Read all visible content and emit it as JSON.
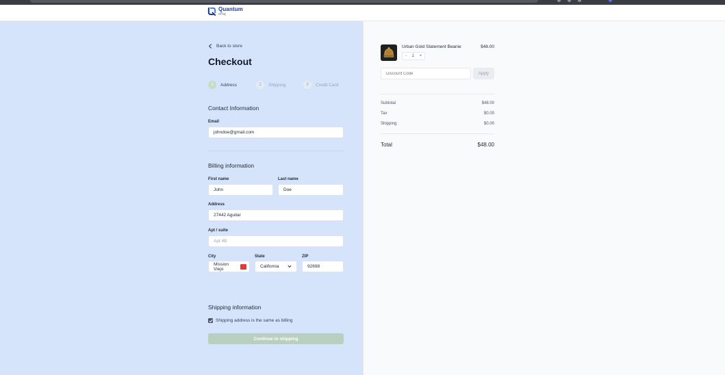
{
  "brand": {
    "name": "Quantum",
    "subtitle": "ePay"
  },
  "nav": {
    "back_label": "Back to store"
  },
  "page": {
    "title": "Checkout"
  },
  "steps": [
    {
      "number": "1",
      "label": "Address"
    },
    {
      "number": "2",
      "label": "Shipping"
    },
    {
      "number": "3",
      "label": "Credit Card"
    }
  ],
  "contact": {
    "title": "Contact Information",
    "email_label": "Email",
    "email_value": "johndoe@gmail.com"
  },
  "billing": {
    "title": "Billing information",
    "first_name_label": "First name",
    "first_name_value": "John",
    "last_name_label": "Last name",
    "last_name_value": "Doe",
    "address_label": "Address",
    "address_value": "27442 Aguilar",
    "apt_label": "Apt / suite",
    "apt_placeholder": "Apt 4B",
    "city_label": "City",
    "city_value": "Mission Viejo",
    "state_label": "State",
    "state_value": "California",
    "zip_label": "ZIP",
    "zip_value": "92698"
  },
  "shipping": {
    "title": "Shipping information",
    "same_as_billing_label": "Shipping address is the same as billing",
    "same_as_billing_checked": true,
    "continue_label": "Continue to shipping"
  },
  "cart": {
    "item_name": "Urban Gold Statement Beanie",
    "item_price": "$48.00",
    "qty_minus": "-",
    "qty_value": "1",
    "qty_plus": "+",
    "discount_placeholder": "Discount Code",
    "apply_label": "Apply"
  },
  "summary": {
    "subtotal_label": "Subtotal",
    "subtotal_value": "$48.00",
    "tax_label": "Tax",
    "tax_value": "$0.00",
    "shipping_label": "Shipping",
    "shipping_value": "$0.00",
    "total_label": "Total",
    "total_value": "$48.00"
  },
  "colors": {
    "left_panel_bg": "#d6e4fb",
    "right_panel_bg": "#f9fafb",
    "button_disabled": "#b9cfbf",
    "active_step": "#c9dcc6",
    "brand": "#1e3a8a"
  }
}
